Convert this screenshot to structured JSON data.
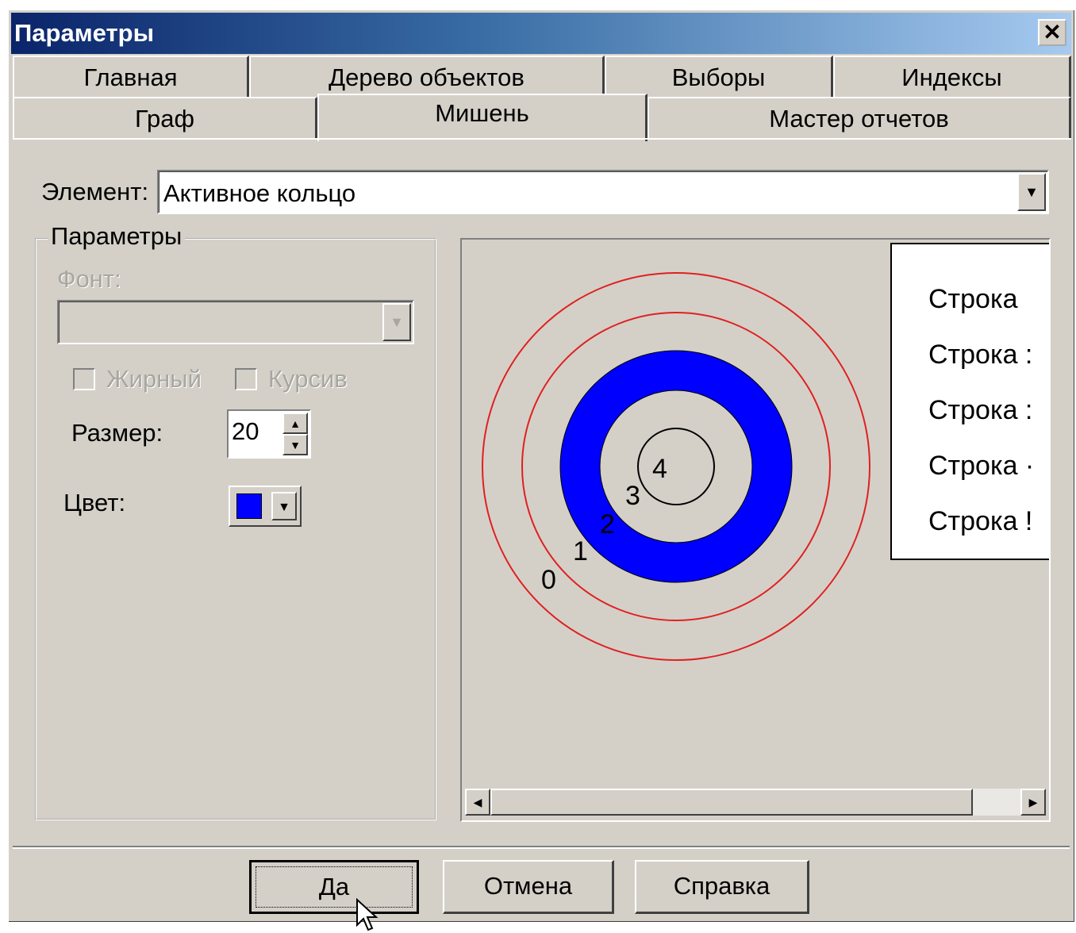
{
  "window": {
    "title": "Параметры"
  },
  "tabs": {
    "row1": [
      "Главная",
      "Дерево объектов",
      "Выборы",
      "Индексы"
    ],
    "row2": [
      "Граф",
      "Мишень",
      "Мастер отчетов"
    ],
    "active": "Мишень"
  },
  "element": {
    "label": "Элемент:",
    "value": "Активное кольцо"
  },
  "params": {
    "title": "Параметры",
    "font_label": "Фонт:",
    "font_value": "",
    "bold_label": "Жирный",
    "italic_label": "Курсив",
    "size_label": "Размер:",
    "size_value": "20",
    "color_label": "Цвет:",
    "color_value": "#0000ff"
  },
  "preview": {
    "ring_labels": [
      "0",
      "1",
      "2",
      "3",
      "4"
    ],
    "active_ring_color": "#0000ff",
    "outer_ring_color": "#e02020",
    "legend": [
      "Строка",
      "Строка :",
      "Строка :",
      "Строка ·",
      "Строка !"
    ]
  },
  "buttons": {
    "ok": "Да",
    "cancel": "Отмена",
    "help": "Справка"
  }
}
